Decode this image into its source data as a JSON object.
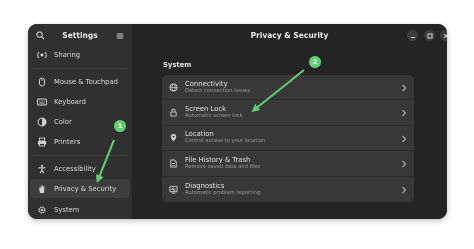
{
  "sidebar": {
    "title": "Settings",
    "items": [
      {
        "label": "Sharing",
        "icon": "sharing-icon"
      },
      {
        "label": "Mouse & Touchpad",
        "icon": "mouse-icon"
      },
      {
        "label": "Keyboard",
        "icon": "keyboard-icon"
      },
      {
        "label": "Color",
        "icon": "color-icon"
      },
      {
        "label": "Printers",
        "icon": "printer-icon"
      },
      {
        "label": "Accessibility",
        "icon": "accessibility-icon"
      },
      {
        "label": "Privacy & Security",
        "icon": "hand-icon",
        "active": true
      },
      {
        "label": "System",
        "icon": "gear-icon"
      }
    ]
  },
  "main": {
    "title": "Privacy & Security",
    "section": "System",
    "rows": [
      {
        "title": "Connectivity",
        "subtitle": "Detect connection issues",
        "icon": "globe-icon"
      },
      {
        "title": "Screen Lock",
        "subtitle": "Automatic screen lock",
        "icon": "lock-icon"
      },
      {
        "title": "Location",
        "subtitle": "Control access to your location",
        "icon": "location-pin-icon"
      },
      {
        "title": "File History & Trash",
        "subtitle": "Remove saved data and files",
        "icon": "file-icon"
      },
      {
        "title": "Diagnostics",
        "subtitle": "Automatic problem reporting",
        "icon": "diagnostics-icon"
      }
    ]
  },
  "annotations": {
    "badge1": "1",
    "badge2": "2",
    "accent": "#5fd170"
  },
  "colors": {
    "sidebar_bg": "#303030",
    "main_bg": "#242424",
    "list_bg": "#383838"
  }
}
